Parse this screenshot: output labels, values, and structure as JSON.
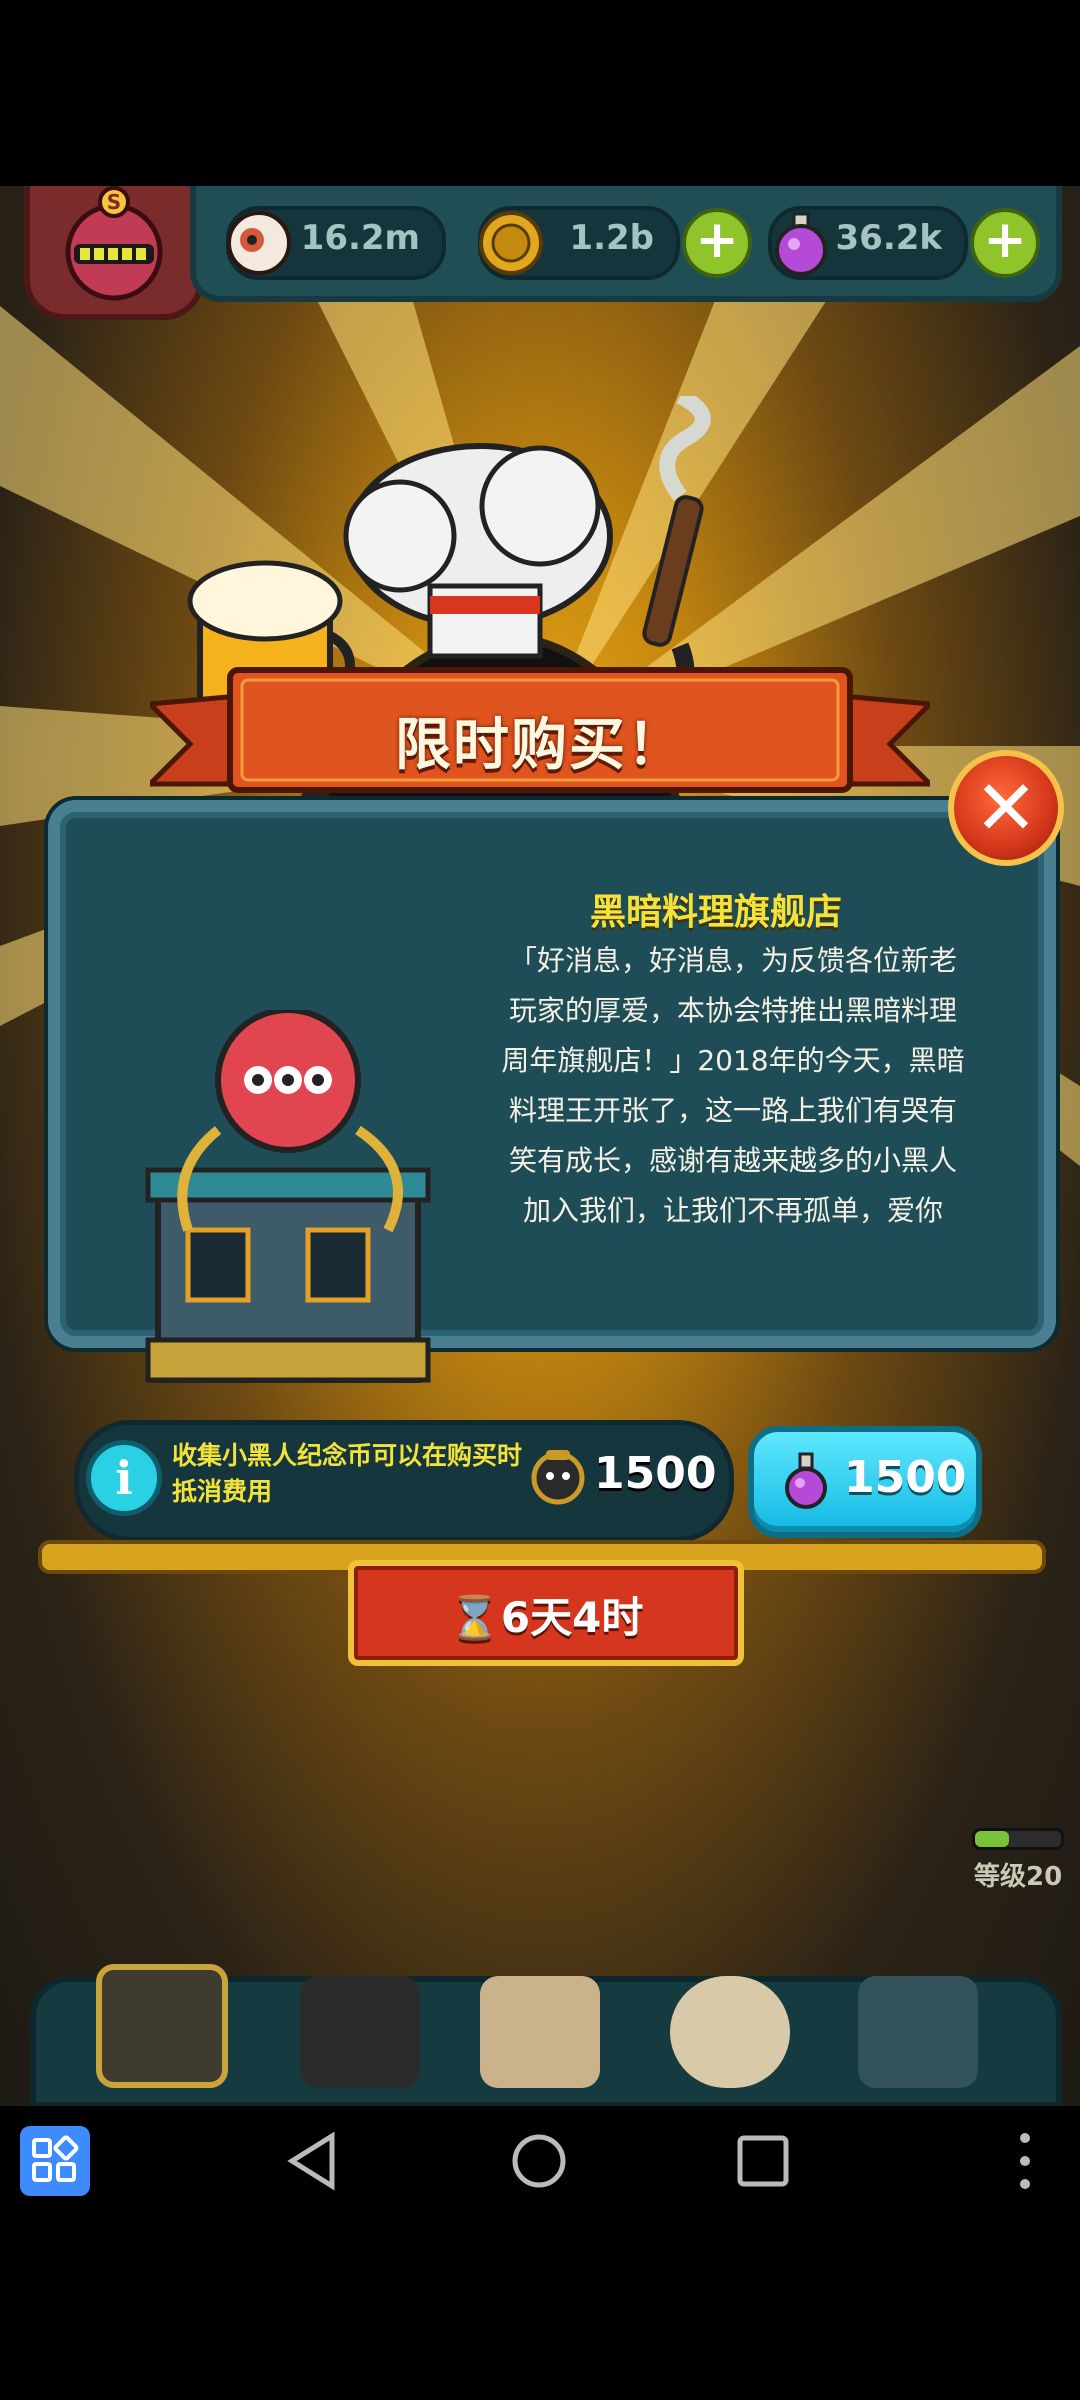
{
  "stats": {
    "eyeballs": "16.2m",
    "coins": "1.2b",
    "potions": "36.2k"
  },
  "banner": {
    "title": "限时购买！"
  },
  "shop": {
    "title": "黑暗料理旗舰店",
    "description_lines": [
      "「好消息，好消息，为反馈各位新老",
      "玩家的厚爱，本协会特推出黑暗料理",
      "周年旗舰店！」2018年的今天，黑暗",
      "料理王开张了，这一路上我们有哭有",
      "笑有成长，感谢有越来越多的小黑人",
      "加入我们，让我们不再孤单，爱你"
    ]
  },
  "purchase": {
    "info_text": "收集小黑人纪念币可以在购买时抵消费用",
    "coin_price": "1500",
    "potion_price": "1500"
  },
  "timer": {
    "label": "6天4时"
  },
  "player": {
    "level": "等级20",
    "level_progress": 0.4
  },
  "colors": {
    "accent_gold": "#f3e23a",
    "buy_button": "#13b8e2",
    "close_button": "#d3361a"
  }
}
